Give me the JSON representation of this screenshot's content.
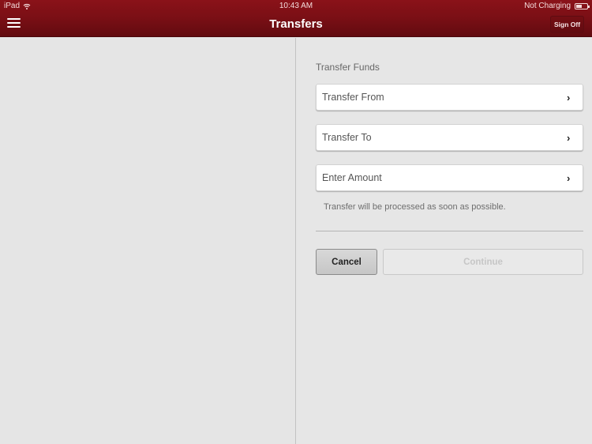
{
  "status_bar": {
    "device": "iPad",
    "time": "10:43 AM",
    "battery_status": "Not Charging",
    "icons": [
      "wifi-icon",
      "battery-icon"
    ]
  },
  "nav_bar": {
    "title": "Transfers",
    "menu_icon": "hamburger-menu-icon",
    "sign_off_label": "Sign Off"
  },
  "transfer_form": {
    "section_label": "Transfer Funds",
    "rows": [
      {
        "label": "Transfer From",
        "icon": "chevron-right-icon"
      },
      {
        "label": "Transfer To",
        "icon": "chevron-right-icon"
      },
      {
        "label": "Enter Amount",
        "icon": "chevron-right-icon"
      }
    ],
    "note": "Transfer will be processed as soon as possible.",
    "cancel_label": "Cancel",
    "continue_label": "Continue",
    "continue_enabled": false
  },
  "colors": {
    "brand_red": "#7a0f15",
    "background": "#e6e6e6"
  }
}
